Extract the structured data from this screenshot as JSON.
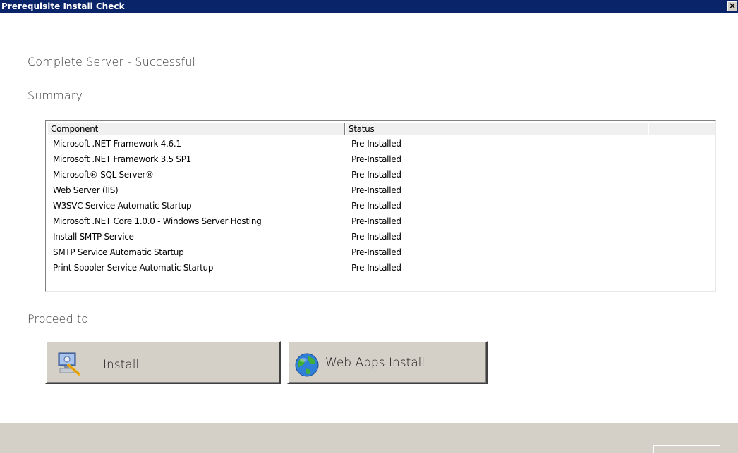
{
  "window": {
    "title": "Prerequisite Install Check",
    "close_label": "×"
  },
  "main": {
    "result_heading": "Complete Server - Successful",
    "summary_heading": "Summary",
    "proceed_heading": "Proceed to"
  },
  "summary_table": {
    "columns": [
      "Component",
      "Status",
      ""
    ],
    "rows": [
      {
        "component": "Microsoft .NET Framework 4.6.1",
        "status": "Pre-Installed"
      },
      {
        "component": "Microsoft .NET Framework 3.5 SP1",
        "status": "Pre-Installed"
      },
      {
        "component": "Microsoft® SQL Server®",
        "status": "Pre-Installed"
      },
      {
        "component": "Web Server (IIS)",
        "status": "Pre-Installed"
      },
      {
        "component": "W3SVC Service Automatic Startup",
        "status": "Pre-Installed"
      },
      {
        "component": "Microsoft .NET Core 1.0.0 - Windows Server Hosting",
        "status": "Pre-Installed"
      },
      {
        "component": "Install SMTP Service",
        "status": "Pre-Installed"
      },
      {
        "component": "SMTP Service Automatic Startup",
        "status": "Pre-Installed"
      },
      {
        "component": "Print Spooler Service Automatic Startup",
        "status": "Pre-Installed"
      }
    ]
  },
  "actions": {
    "install_label": "Install",
    "install_icon": "install-computer-icon",
    "web_apps_label": "Web Apps Install",
    "web_apps_icon": "globe-icon"
  },
  "colors": {
    "titlebar": "#0a246a",
    "button_face": "#d4d0c8"
  }
}
